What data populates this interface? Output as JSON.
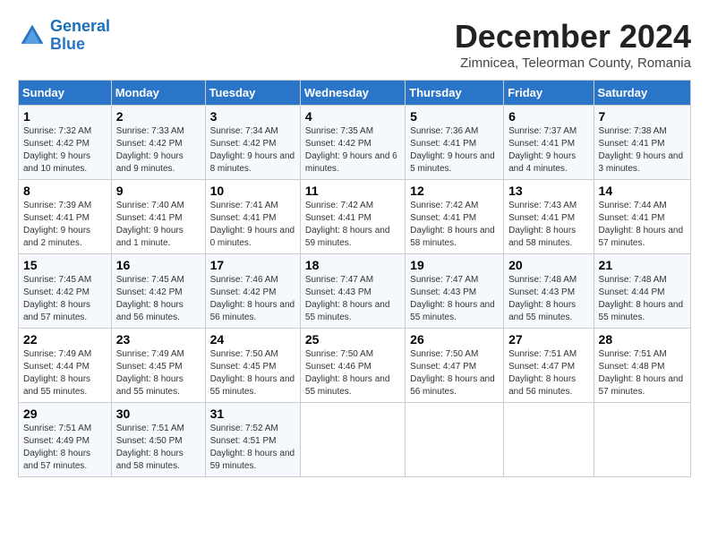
{
  "logo": {
    "line1": "General",
    "line2": "Blue"
  },
  "title": "December 2024",
  "subtitle": "Zimnicea, Teleorman County, Romania",
  "headers": [
    "Sunday",
    "Monday",
    "Tuesday",
    "Wednesday",
    "Thursday",
    "Friday",
    "Saturday"
  ],
  "weeks": [
    [
      {
        "day": "1",
        "sunrise": "Sunrise: 7:32 AM",
        "sunset": "Sunset: 4:42 PM",
        "daylight": "Daylight: 9 hours and 10 minutes."
      },
      {
        "day": "2",
        "sunrise": "Sunrise: 7:33 AM",
        "sunset": "Sunset: 4:42 PM",
        "daylight": "Daylight: 9 hours and 9 minutes."
      },
      {
        "day": "3",
        "sunrise": "Sunrise: 7:34 AM",
        "sunset": "Sunset: 4:42 PM",
        "daylight": "Daylight: 9 hours and 8 minutes."
      },
      {
        "day": "4",
        "sunrise": "Sunrise: 7:35 AM",
        "sunset": "Sunset: 4:42 PM",
        "daylight": "Daylight: 9 hours and 6 minutes."
      },
      {
        "day": "5",
        "sunrise": "Sunrise: 7:36 AM",
        "sunset": "Sunset: 4:41 PM",
        "daylight": "Daylight: 9 hours and 5 minutes."
      },
      {
        "day": "6",
        "sunrise": "Sunrise: 7:37 AM",
        "sunset": "Sunset: 4:41 PM",
        "daylight": "Daylight: 9 hours and 4 minutes."
      },
      {
        "day": "7",
        "sunrise": "Sunrise: 7:38 AM",
        "sunset": "Sunset: 4:41 PM",
        "daylight": "Daylight: 9 hours and 3 minutes."
      }
    ],
    [
      {
        "day": "8",
        "sunrise": "Sunrise: 7:39 AM",
        "sunset": "Sunset: 4:41 PM",
        "daylight": "Daylight: 9 hours and 2 minutes."
      },
      {
        "day": "9",
        "sunrise": "Sunrise: 7:40 AM",
        "sunset": "Sunset: 4:41 PM",
        "daylight": "Daylight: 9 hours and 1 minute."
      },
      {
        "day": "10",
        "sunrise": "Sunrise: 7:41 AM",
        "sunset": "Sunset: 4:41 PM",
        "daylight": "Daylight: 9 hours and 0 minutes."
      },
      {
        "day": "11",
        "sunrise": "Sunrise: 7:42 AM",
        "sunset": "Sunset: 4:41 PM",
        "daylight": "Daylight: 8 hours and 59 minutes."
      },
      {
        "day": "12",
        "sunrise": "Sunrise: 7:42 AM",
        "sunset": "Sunset: 4:41 PM",
        "daylight": "Daylight: 8 hours and 58 minutes."
      },
      {
        "day": "13",
        "sunrise": "Sunrise: 7:43 AM",
        "sunset": "Sunset: 4:41 PM",
        "daylight": "Daylight: 8 hours and 58 minutes."
      },
      {
        "day": "14",
        "sunrise": "Sunrise: 7:44 AM",
        "sunset": "Sunset: 4:41 PM",
        "daylight": "Daylight: 8 hours and 57 minutes."
      }
    ],
    [
      {
        "day": "15",
        "sunrise": "Sunrise: 7:45 AM",
        "sunset": "Sunset: 4:42 PM",
        "daylight": "Daylight: 8 hours and 57 minutes."
      },
      {
        "day": "16",
        "sunrise": "Sunrise: 7:45 AM",
        "sunset": "Sunset: 4:42 PM",
        "daylight": "Daylight: 8 hours and 56 minutes."
      },
      {
        "day": "17",
        "sunrise": "Sunrise: 7:46 AM",
        "sunset": "Sunset: 4:42 PM",
        "daylight": "Daylight: 8 hours and 56 minutes."
      },
      {
        "day": "18",
        "sunrise": "Sunrise: 7:47 AM",
        "sunset": "Sunset: 4:43 PM",
        "daylight": "Daylight: 8 hours and 55 minutes."
      },
      {
        "day": "19",
        "sunrise": "Sunrise: 7:47 AM",
        "sunset": "Sunset: 4:43 PM",
        "daylight": "Daylight: 8 hours and 55 minutes."
      },
      {
        "day": "20",
        "sunrise": "Sunrise: 7:48 AM",
        "sunset": "Sunset: 4:43 PM",
        "daylight": "Daylight: 8 hours and 55 minutes."
      },
      {
        "day": "21",
        "sunrise": "Sunrise: 7:48 AM",
        "sunset": "Sunset: 4:44 PM",
        "daylight": "Daylight: 8 hours and 55 minutes."
      }
    ],
    [
      {
        "day": "22",
        "sunrise": "Sunrise: 7:49 AM",
        "sunset": "Sunset: 4:44 PM",
        "daylight": "Daylight: 8 hours and 55 minutes."
      },
      {
        "day": "23",
        "sunrise": "Sunrise: 7:49 AM",
        "sunset": "Sunset: 4:45 PM",
        "daylight": "Daylight: 8 hours and 55 minutes."
      },
      {
        "day": "24",
        "sunrise": "Sunrise: 7:50 AM",
        "sunset": "Sunset: 4:45 PM",
        "daylight": "Daylight: 8 hours and 55 minutes."
      },
      {
        "day": "25",
        "sunrise": "Sunrise: 7:50 AM",
        "sunset": "Sunset: 4:46 PM",
        "daylight": "Daylight: 8 hours and 55 minutes."
      },
      {
        "day": "26",
        "sunrise": "Sunrise: 7:50 AM",
        "sunset": "Sunset: 4:47 PM",
        "daylight": "Daylight: 8 hours and 56 minutes."
      },
      {
        "day": "27",
        "sunrise": "Sunrise: 7:51 AM",
        "sunset": "Sunset: 4:47 PM",
        "daylight": "Daylight: 8 hours and 56 minutes."
      },
      {
        "day": "28",
        "sunrise": "Sunrise: 7:51 AM",
        "sunset": "Sunset: 4:48 PM",
        "daylight": "Daylight: 8 hours and 57 minutes."
      }
    ],
    [
      {
        "day": "29",
        "sunrise": "Sunrise: 7:51 AM",
        "sunset": "Sunset: 4:49 PM",
        "daylight": "Daylight: 8 hours and 57 minutes."
      },
      {
        "day": "30",
        "sunrise": "Sunrise: 7:51 AM",
        "sunset": "Sunset: 4:50 PM",
        "daylight": "Daylight: 8 hours and 58 minutes."
      },
      {
        "day": "31",
        "sunrise": "Sunrise: 7:52 AM",
        "sunset": "Sunset: 4:51 PM",
        "daylight": "Daylight: 8 hours and 59 minutes."
      },
      null,
      null,
      null,
      null
    ]
  ]
}
